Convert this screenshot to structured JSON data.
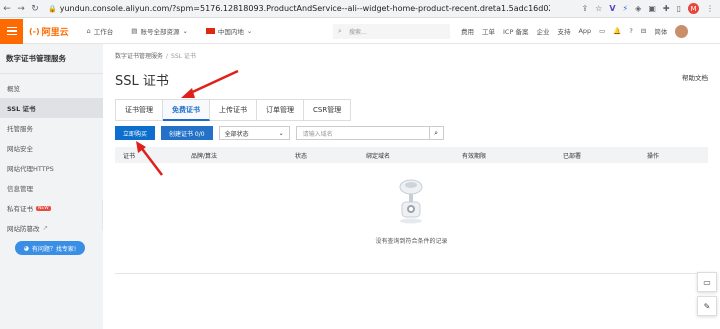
{
  "browser": {
    "url": "yundun.console.aliyun.com/?spm=5176.12818093.ProductAndService--ali--widget-home-product-recent.dreta1.5adc16d02jXJE...",
    "profile_initial": "M"
  },
  "topbar": {
    "logo_text": "阿里云",
    "workbench": "工作台",
    "account_resources": "账号全部资源",
    "region": "中国内地",
    "search_placeholder": "搜索...",
    "links": [
      "费用",
      "工单",
      "ICP 备案",
      "企业",
      "支持",
      "App"
    ],
    "language": "简体",
    "brand_color": "#ff6a00"
  },
  "sidebar": {
    "title": "数字证书管理服务",
    "items": [
      {
        "label": "概览"
      },
      {
        "label": "SSL 证书",
        "active": true
      },
      {
        "label": "托管服务"
      },
      {
        "label": "网站安全"
      },
      {
        "label": "网站代理HTTPS"
      },
      {
        "label": "信息管理"
      },
      {
        "label": "私有证书",
        "badge": "NEW"
      },
      {
        "label": "网站防篡改"
      }
    ],
    "help_button": "有问题？找专家!"
  },
  "main": {
    "breadcrumb": [
      "数字证书管理服务",
      "SSL 证书"
    ],
    "page_title": "SSL 证书",
    "help_doc": "帮助文档",
    "tabs": [
      {
        "label": "证书管理"
      },
      {
        "label": "免费证书",
        "active": true
      },
      {
        "label": "上传证书"
      },
      {
        "label": "订单管理"
      },
      {
        "label": "CSR管理"
      }
    ],
    "buy_button": "立即购买",
    "create_button": "创建证书 0/0",
    "status_select": "全部状态",
    "domain_search_placeholder": "请输入域名",
    "columns": [
      "证书",
      "品牌/算法",
      "状态",
      "绑定域名",
      "有效期限",
      "已部署",
      "操作"
    ],
    "empty_text": "没有查询到符合条件的记录"
  }
}
